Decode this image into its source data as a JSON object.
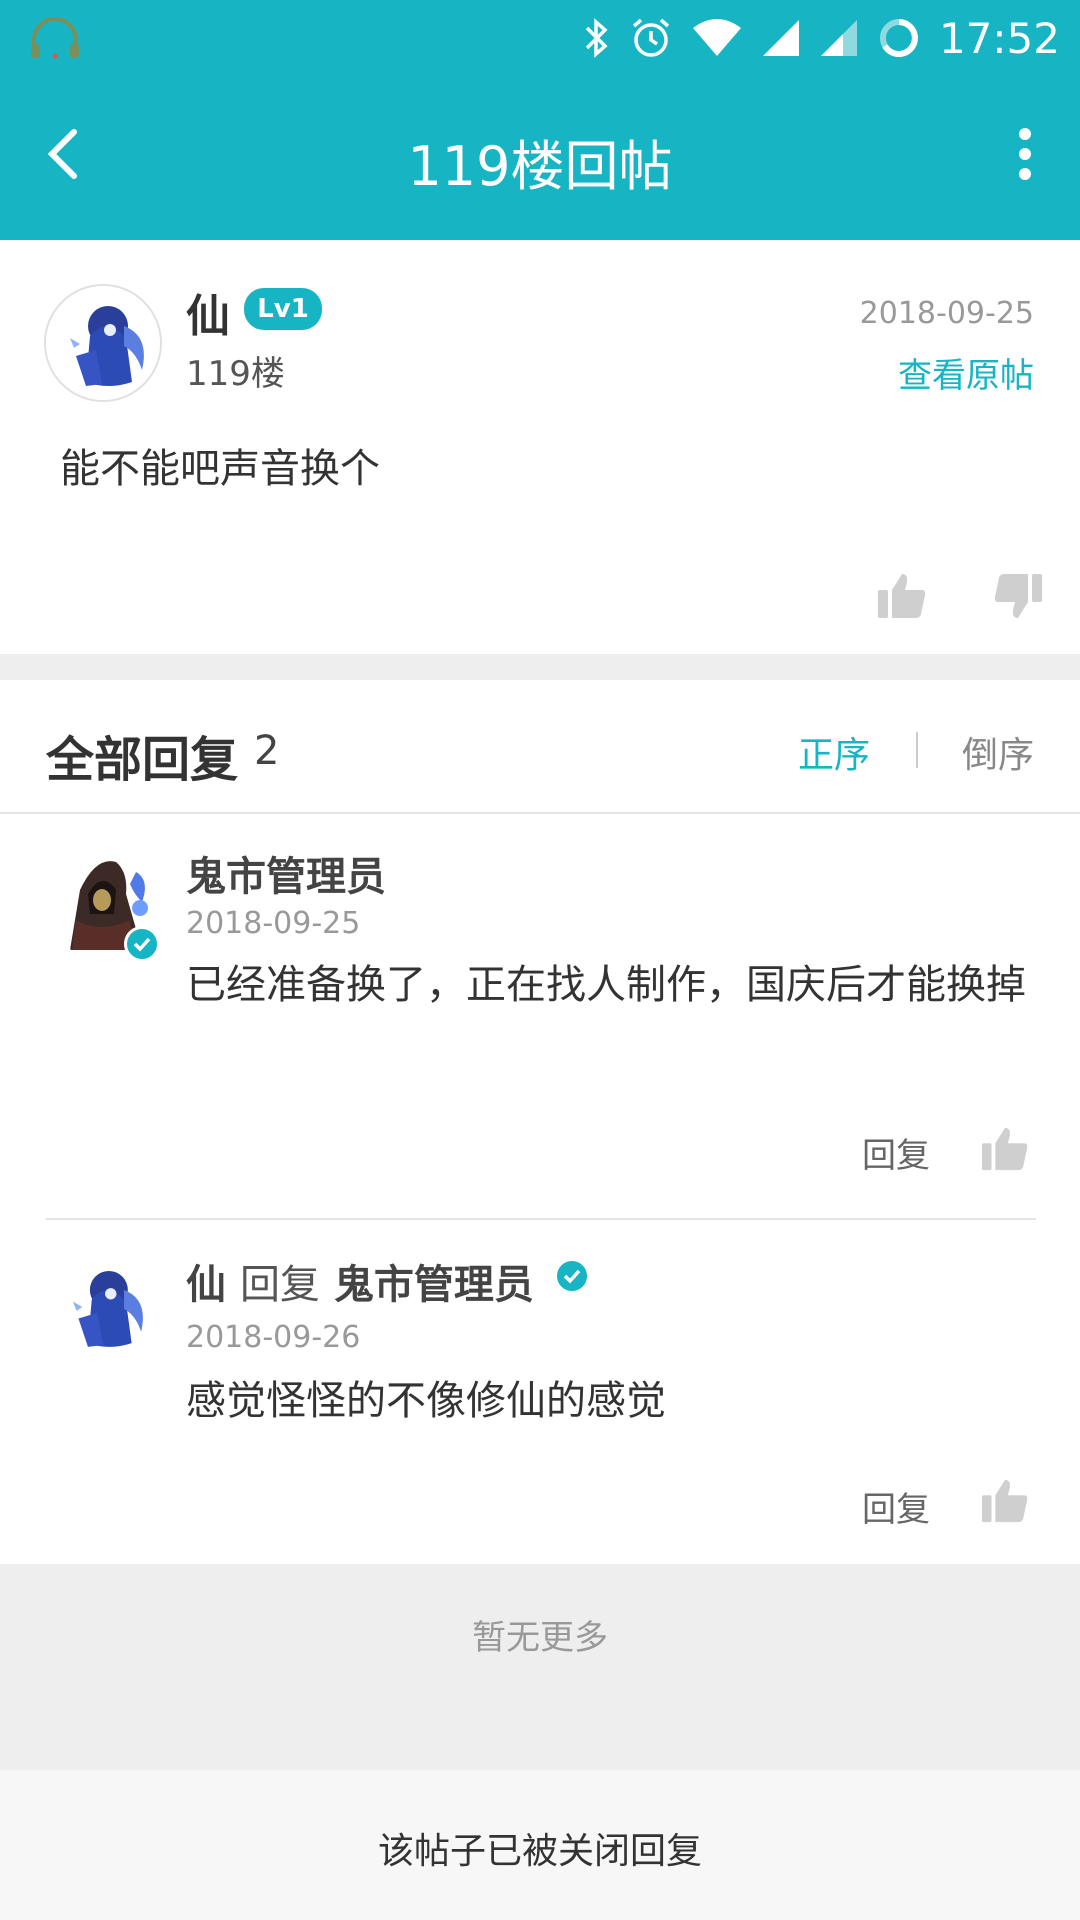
{
  "status_bar": {
    "time": "17:52",
    "icons": [
      "headphones-icon",
      "bluetooth-icon",
      "alarm-icon",
      "wifi-icon",
      "signal-icon",
      "signal-weak-icon",
      "battery-ring-icon"
    ]
  },
  "app_bar": {
    "title": "119楼回帖",
    "back_icon": "back-arrow-icon",
    "more_icon": "more-vertical-icon"
  },
  "post": {
    "author": "仙",
    "level": "Lv1",
    "floor": "119楼",
    "date": "2018-09-25",
    "view_original": "查看原帖",
    "content": "能不能吧声音换个"
  },
  "replies": {
    "title": "全部回复",
    "count": "2",
    "sort_asc": "正序",
    "sort_desc": "倒序",
    "items": [
      {
        "author": "鬼市管理员",
        "date": "2018-09-25",
        "text": "已经准备换了，正在找人制作，国庆后才能换掉",
        "reply_label": "回复",
        "verified": true
      },
      {
        "author": "仙",
        "verb": "回复",
        "target": "鬼市管理员",
        "date": "2018-09-26",
        "text": "感觉怪怪的不像修仙的感觉",
        "reply_label": "回复"
      }
    ]
  },
  "footer": {
    "no_more": "暂无更多",
    "closed": "该帖子已被关闭回复"
  },
  "colors": {
    "accent": "#17b5c4",
    "muted_bg": "#eeeeee"
  }
}
